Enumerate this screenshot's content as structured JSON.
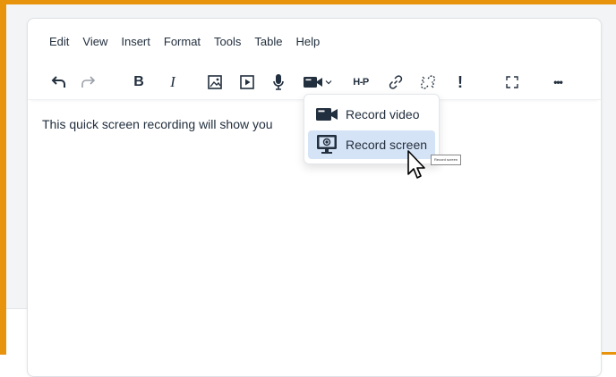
{
  "menubar": {
    "edit": "Edit",
    "view": "View",
    "insert": "Insert",
    "format": "Format",
    "tools": "Tools",
    "table": "Table",
    "help": "Help"
  },
  "toolbar": {
    "bold_label": "B",
    "italic_label": "I",
    "h5p_label": "H-P",
    "exclaim_label": "!",
    "more_label": "•••",
    "icons": [
      "undo-icon",
      "redo-icon",
      "bold-icon",
      "italic-icon",
      "image-icon",
      "media-icon",
      "microphone-icon",
      "video-camera-icon",
      "chevron-down-icon",
      "h5p-icon",
      "link-icon",
      "unlink-icon",
      "accessibility-icon",
      "fullscreen-icon",
      "more-icon"
    ]
  },
  "content": {
    "text": "This quick screen recording will show you"
  },
  "dropdown": {
    "items": [
      {
        "label": "Record video",
        "icon": "video-camera-icon"
      },
      {
        "label": "Record screen",
        "icon": "screen-record-icon",
        "active": true
      }
    ]
  },
  "tooltip": {
    "text": "Record screen"
  },
  "colors": {
    "frame_border": "#e8930c",
    "active_item": "#d5e3f6",
    "text": "#222f3e"
  }
}
